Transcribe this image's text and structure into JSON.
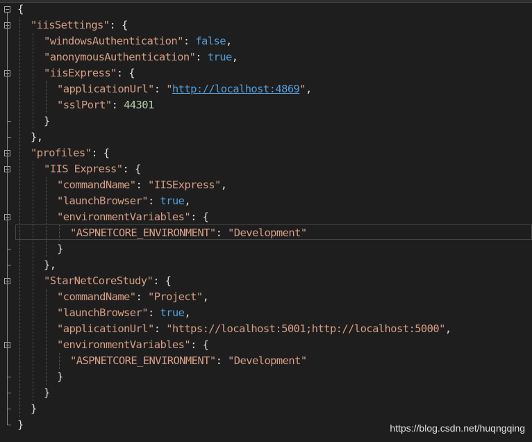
{
  "lines": [
    {
      "indent": 0,
      "fold": true,
      "parts": [
        {
          "t": "{",
          "c": "punc"
        }
      ]
    },
    {
      "indent": 1,
      "fold": true,
      "parts": [
        {
          "t": "\"iisSettings\"",
          "c": "key"
        },
        {
          "t": ": {",
          "c": "punc"
        }
      ]
    },
    {
      "indent": 2,
      "fold": false,
      "parts": [
        {
          "t": "\"windowsAuthentication\"",
          "c": "key"
        },
        {
          "t": ": ",
          "c": "punc"
        },
        {
          "t": "false",
          "c": "bool"
        },
        {
          "t": ",",
          "c": "punc"
        }
      ]
    },
    {
      "indent": 2,
      "fold": false,
      "parts": [
        {
          "t": "\"anonymousAuthentication\"",
          "c": "key"
        },
        {
          "t": ": ",
          "c": "punc"
        },
        {
          "t": "true",
          "c": "bool"
        },
        {
          "t": ",",
          "c": "punc"
        }
      ]
    },
    {
      "indent": 2,
      "fold": true,
      "parts": [
        {
          "t": "\"iisExpress\"",
          "c": "key"
        },
        {
          "t": ": {",
          "c": "punc"
        }
      ]
    },
    {
      "indent": 3,
      "fold": false,
      "parts": [
        {
          "t": "\"applicationUrl\"",
          "c": "key"
        },
        {
          "t": ": ",
          "c": "punc"
        },
        {
          "t": "\"",
          "c": "str"
        },
        {
          "t": "http://localhost:4869",
          "c": "url"
        },
        {
          "t": "\"",
          "c": "str"
        },
        {
          "t": ",",
          "c": "punc"
        }
      ]
    },
    {
      "indent": 3,
      "fold": false,
      "parts": [
        {
          "t": "\"sslPort\"",
          "c": "key"
        },
        {
          "t": ": ",
          "c": "punc"
        },
        {
          "t": "44301",
          "c": "num"
        }
      ]
    },
    {
      "indent": 2,
      "fold": false,
      "parts": [
        {
          "t": "}",
          "c": "punc"
        }
      ]
    },
    {
      "indent": 1,
      "fold": false,
      "parts": [
        {
          "t": "},",
          "c": "punc"
        }
      ]
    },
    {
      "indent": 1,
      "fold": true,
      "parts": [
        {
          "t": "\"profiles\"",
          "c": "key"
        },
        {
          "t": ": {",
          "c": "punc"
        }
      ]
    },
    {
      "indent": 2,
      "fold": true,
      "parts": [
        {
          "t": "\"IIS Express\"",
          "c": "key"
        },
        {
          "t": ": {",
          "c": "punc"
        }
      ]
    },
    {
      "indent": 3,
      "fold": false,
      "parts": [
        {
          "t": "\"commandName\"",
          "c": "key"
        },
        {
          "t": ": ",
          "c": "punc"
        },
        {
          "t": "\"IISExpress\"",
          "c": "str"
        },
        {
          "t": ",",
          "c": "punc"
        }
      ]
    },
    {
      "indent": 3,
      "fold": false,
      "parts": [
        {
          "t": "\"launchBrowser\"",
          "c": "key"
        },
        {
          "t": ": ",
          "c": "punc"
        },
        {
          "t": "true",
          "c": "bool"
        },
        {
          "t": ",",
          "c": "punc"
        }
      ]
    },
    {
      "indent": 3,
      "fold": true,
      "parts": [
        {
          "t": "\"environmentVariables\"",
          "c": "key"
        },
        {
          "t": ": {",
          "c": "punc"
        }
      ]
    },
    {
      "indent": 4,
      "fold": false,
      "parts": [
        {
          "t": "\"ASPNETCORE_ENVIRONMENT\"",
          "c": "key"
        },
        {
          "t": ": ",
          "c": "punc"
        },
        {
          "t": "\"Development\"",
          "c": "str"
        }
      ]
    },
    {
      "indent": 3,
      "fold": false,
      "parts": [
        {
          "t": "}",
          "c": "punc"
        }
      ]
    },
    {
      "indent": 2,
      "fold": false,
      "parts": [
        {
          "t": "},",
          "c": "punc"
        }
      ]
    },
    {
      "indent": 2,
      "fold": true,
      "parts": [
        {
          "t": "\"StarNetCoreStudy\"",
          "c": "key"
        },
        {
          "t": ": {",
          "c": "punc"
        }
      ]
    },
    {
      "indent": 3,
      "fold": false,
      "parts": [
        {
          "t": "\"commandName\"",
          "c": "key"
        },
        {
          "t": ": ",
          "c": "punc"
        },
        {
          "t": "\"Project\"",
          "c": "str"
        },
        {
          "t": ",",
          "c": "punc"
        }
      ]
    },
    {
      "indent": 3,
      "fold": false,
      "parts": [
        {
          "t": "\"launchBrowser\"",
          "c": "key"
        },
        {
          "t": ": ",
          "c": "punc"
        },
        {
          "t": "true",
          "c": "bool"
        },
        {
          "t": ",",
          "c": "punc"
        }
      ]
    },
    {
      "indent": 3,
      "fold": false,
      "parts": [
        {
          "t": "\"applicationUrl\"",
          "c": "key"
        },
        {
          "t": ": ",
          "c": "punc"
        },
        {
          "t": "\"https://localhost:5001;http://localhost:5000\"",
          "c": "str"
        },
        {
          "t": ",",
          "c": "punc"
        }
      ]
    },
    {
      "indent": 3,
      "fold": true,
      "parts": [
        {
          "t": "\"environmentVariables\"",
          "c": "key"
        },
        {
          "t": ": {",
          "c": "punc"
        }
      ]
    },
    {
      "indent": 4,
      "fold": false,
      "parts": [
        {
          "t": "\"ASPNETCORE_ENVIRONMENT\"",
          "c": "key"
        },
        {
          "t": ": ",
          "c": "punc"
        },
        {
          "t": "\"Development\"",
          "c": "str"
        }
      ]
    },
    {
      "indent": 3,
      "fold": false,
      "parts": [
        {
          "t": "}",
          "c": "punc"
        }
      ]
    },
    {
      "indent": 2,
      "fold": false,
      "parts": [
        {
          "t": "}",
          "c": "punc"
        }
      ]
    },
    {
      "indent": 1,
      "fold": false,
      "parts": [
        {
          "t": "}",
          "c": "punc"
        }
      ]
    },
    {
      "indent": 0,
      "fold": false,
      "parts": [
        {
          "t": "}",
          "c": "punc"
        }
      ]
    }
  ],
  "current_line": 14,
  "watermark": "https://blog.csdn.net/huqngqing",
  "colors": {
    "background": "#1e1e1e",
    "string": "#d69d85",
    "keyword": "#569cd6",
    "number": "#b5cea8",
    "punctuation": "#dcdcdc"
  }
}
